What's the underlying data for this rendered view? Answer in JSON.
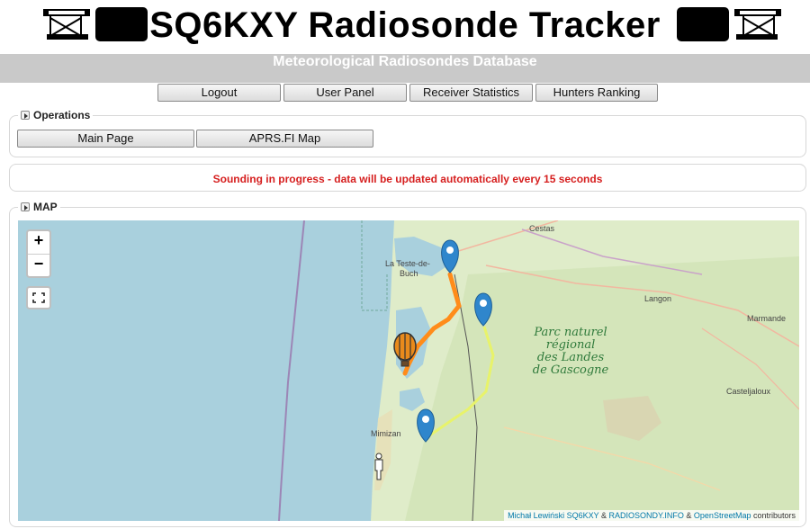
{
  "header": {
    "title": "SQ6KXY Radiosonde Tracker",
    "subtitle": "Meteorological Radiosondes Database"
  },
  "nav": {
    "logout": "Logout",
    "user_panel": "User Panel",
    "receiver_statistics": "Receiver Statistics",
    "hunters_ranking": "Hunters Ranking"
  },
  "operations": {
    "legend": "Operations",
    "main_page": "Main Page",
    "aprs_map": "APRS.FI Map"
  },
  "status": {
    "text": "Sounding in progress - data will be updated automatically every 15 seconds",
    "color": "#d61f1f"
  },
  "map": {
    "legend": "MAP",
    "zoom_in": "+",
    "zoom_out": "−",
    "labels": {
      "cestas": "Cestas",
      "la_teste": "La Teste-de-",
      "buch": "Buch",
      "langon": "Langon",
      "marmande": "Marmande",
      "casteljaloux": "Casteljaloux",
      "mimizan": "Mimizan"
    },
    "park": {
      "line1": "Parc naturel",
      "line2": "régional",
      "line3": "des Landes",
      "line4": "de Gascogne"
    },
    "attribution": {
      "author": "Michał Lewiński SQ6KXY",
      "sep1": " & ",
      "site": "RADIOSONDY.INFO",
      "sep2": " & ",
      "osm": "OpenStreetMap",
      "suffix": " contributors"
    },
    "colors": {
      "sea": "#a9d0dd",
      "land": "#dfecc9",
      "ascent_track": "#ff8c1a",
      "descent_track": "#e8f36a",
      "marker": "#2f86cc",
      "park_text": "#2f7a3b"
    }
  }
}
